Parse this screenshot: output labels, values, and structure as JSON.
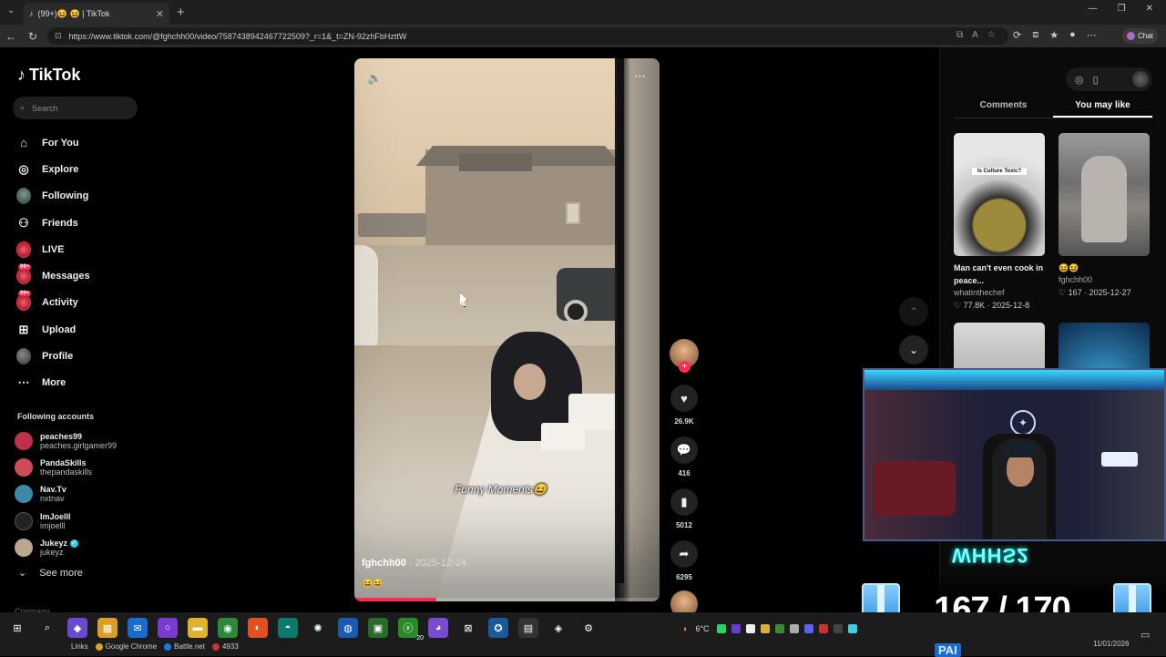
{
  "browser": {
    "tab_title": "(99+)😆 😆 | TikTok",
    "url": "https://www.tiktok.com/@fghchh00/video/7587438942467722509?_r=1&_t=ZN-92zhFbHzttW",
    "chat_label": "Chat"
  },
  "sidebar": {
    "logo": "TikTok",
    "search_placeholder": "Search",
    "nav": [
      {
        "label": "For You",
        "icon": "home-icon"
      },
      {
        "label": "Explore",
        "icon": "compass-icon"
      },
      {
        "label": "Following",
        "icon": "avatar"
      },
      {
        "label": "Friends",
        "icon": "friends-icon"
      },
      {
        "label": "LIVE",
        "icon": "live-icon"
      },
      {
        "label": "Messages",
        "icon": "messages-icon",
        "badge": "99+"
      },
      {
        "label": "Activity",
        "icon": "activity-icon",
        "badge": "99+"
      },
      {
        "label": "Upload",
        "icon": "upload-icon"
      },
      {
        "label": "Profile",
        "icon": "profile-avatar"
      },
      {
        "label": "More",
        "icon": "more-icon"
      }
    ],
    "following_title": "Following accounts",
    "following": [
      {
        "name": "peaches99",
        "handle": "peaches.girlgamer99",
        "color": "#c0304a"
      },
      {
        "name": "PandaSkills",
        "handle": "thepandaskills",
        "color": "#d04a5a"
      },
      {
        "name": "Nav.Tv",
        "handle": "nxtnav",
        "color": "#3a8aa8"
      },
      {
        "name": "ImJoelll",
        "handle": "imjoelll",
        "color": "#222222"
      },
      {
        "name": "Jukeyz",
        "handle": "jukeyz",
        "color": "#bca890",
        "verified": true
      }
    ],
    "see_more": "See more",
    "company": "Company"
  },
  "video": {
    "caption": "Funny Moments😆",
    "author": "fghchh00",
    "date": "2025-12-24",
    "description": "😆😆",
    "progress": 0.27
  },
  "actions": {
    "likes": "26.9K",
    "comments": "416",
    "saves": "5012",
    "shares": "6295"
  },
  "right_panel": {
    "tabs": [
      "Comments",
      "You may like"
    ],
    "active_tab": "You may like",
    "cards": [
      {
        "title": "Man can't even cook in peace...",
        "user": "whatinthechef",
        "likes": "77.8K",
        "date": "2025-12-8",
        "thumb_label": "Is Culture Toxic?"
      },
      {
        "title": "😆😆",
        "user": "fghchh00",
        "likes": "167",
        "date": "2025-12-27"
      }
    ]
  },
  "overlay": {
    "counter": "167 / 170",
    "neon_text": "WHHS2",
    "sub_tag": "PAI"
  },
  "taskbar": {
    "links_label": "Links",
    "shortcuts": [
      "Google Chrome",
      "Battle.net",
      "4933"
    ],
    "weather": "6°C",
    "date": "11/01/2026",
    "xbox_badge": "20"
  }
}
